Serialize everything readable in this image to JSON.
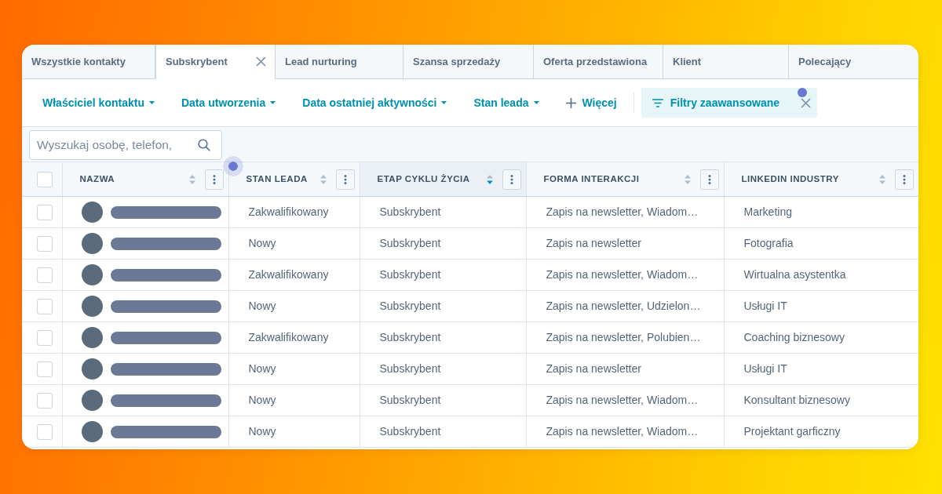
{
  "tabs": [
    {
      "label": "Wszystkie kontakty",
      "selected": false,
      "closable": false
    },
    {
      "label": "Subskrybent",
      "selected": true,
      "closable": true
    },
    {
      "label": "Lead nurturing",
      "selected": false,
      "closable": false
    },
    {
      "label": "Szansa sprzedaży",
      "selected": false,
      "closable": false
    },
    {
      "label": "Oferta przedstawiona",
      "selected": false,
      "closable": false
    },
    {
      "label": "Klient",
      "selected": false,
      "closable": false
    },
    {
      "label": "Polecający",
      "selected": false,
      "closable": false
    }
  ],
  "filters": [
    {
      "kind": "dropdown",
      "label": "Właściciel kontaktu"
    },
    {
      "kind": "dropdown",
      "label": "Data utworzenia"
    },
    {
      "kind": "dropdown",
      "label": "Data ostatniej aktywności"
    },
    {
      "kind": "dropdown",
      "label": "Stan leada"
    },
    {
      "kind": "add",
      "label": "Więcej"
    }
  ],
  "advanced_filters": {
    "label": "Filtry zaawansowane"
  },
  "search": {
    "placeholder": "Wyszukaj osobę, telefon,"
  },
  "table": {
    "select_all_checked": false,
    "columns": [
      {
        "label": "NAZWA",
        "kind": "contact",
        "sorted": false
      },
      {
        "label": "STAN LEADA",
        "kind": "text",
        "sorted": false
      },
      {
        "label": "ETAP CYKLU ŻYCIA",
        "kind": "text",
        "sorted": true
      },
      {
        "label": "FORMA INTERAKCJI",
        "kind": "text",
        "sorted": false
      },
      {
        "label": "LINKEDIN INDUSTRY",
        "kind": "text",
        "sorted": false
      }
    ],
    "rows": [
      {
        "checked": false,
        "cells": [
          "",
          "Zakwalifikowany",
          "Subskrybent",
          "Zapis na newsletter, Wiadom…",
          "Marketing"
        ]
      },
      {
        "checked": false,
        "cells": [
          "",
          "Nowy",
          "Subskrybent",
          "Zapis na newsletter",
          "Fotografia"
        ]
      },
      {
        "checked": false,
        "cells": [
          "",
          "Zakwalifikowany",
          "Subskrybent",
          "Zapis na newsletter, Wiadom…",
          "Wirtualna asystentka"
        ]
      },
      {
        "checked": false,
        "cells": [
          "",
          "Nowy",
          "Subskrybent",
          "Zapis na newsletter, Udzielon…",
          "Usługi IT"
        ]
      },
      {
        "checked": false,
        "cells": [
          "",
          "Zakwalifikowany",
          "Subskrybent",
          "Zapis na newsletter, Polubien…",
          "Coaching biznesowy"
        ]
      },
      {
        "checked": false,
        "cells": [
          "",
          "Nowy",
          "Subskrybent",
          "Zapis na newsletter",
          "Usługi IT"
        ]
      },
      {
        "checked": false,
        "cells": [
          "",
          "Nowy",
          "Subskrybent",
          "Zapis na newsletter, Wiadom…",
          "Konsultant biznesowy"
        ]
      },
      {
        "checked": false,
        "cells": [
          "",
          "Nowy",
          "Subskrybent",
          "Zapis na newsletter, Wiadom…",
          "Projektant garficzny"
        ]
      }
    ]
  }
}
